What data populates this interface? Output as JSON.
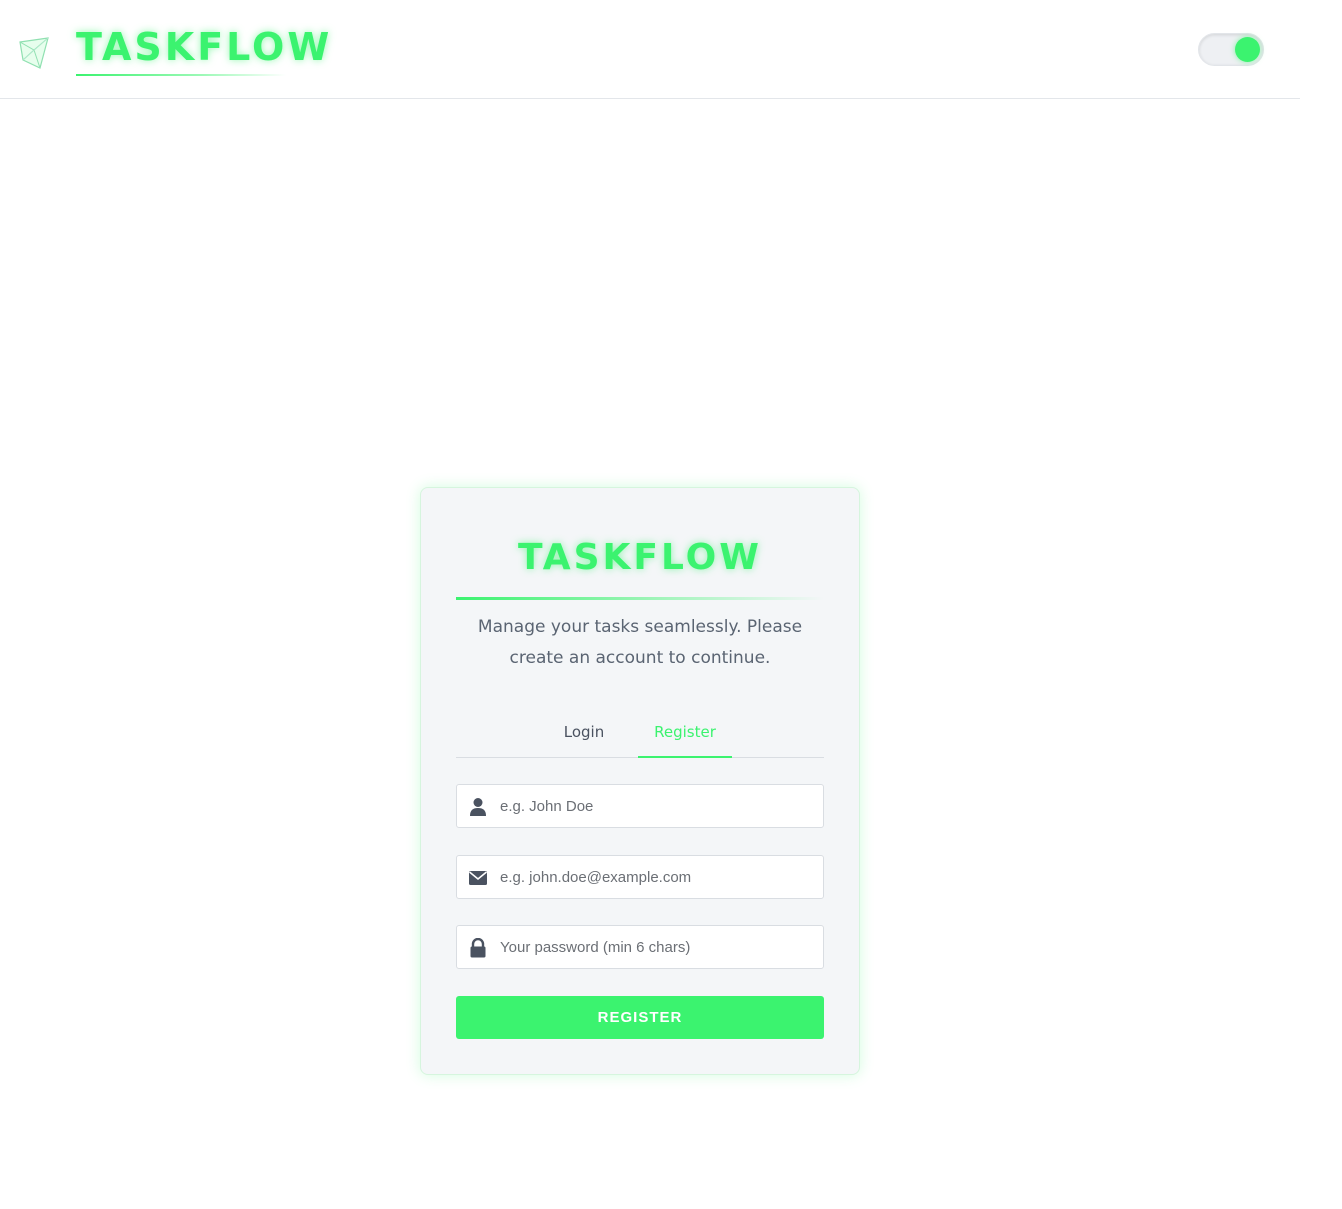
{
  "header": {
    "brand": "TASKFLOW",
    "logo_icon": "crystal-logo-icon",
    "theme_toggle": {
      "icon": "toggle-switch",
      "state": "on"
    }
  },
  "card": {
    "title": "TASKFLOW",
    "subtitle": "Manage your tasks seamlessly. Please create an account to continue.",
    "tabs": [
      {
        "label": "Login",
        "active": false
      },
      {
        "label": "Register",
        "active": true
      }
    ],
    "fields": {
      "name": {
        "icon": "user-icon",
        "placeholder": "e.g. John Doe",
        "value": ""
      },
      "email": {
        "icon": "envelope-icon",
        "placeholder": "e.g. john.doe@example.com",
        "value": ""
      },
      "password": {
        "icon": "lock-icon",
        "placeholder": "Your password (min 6 chars)",
        "value": ""
      }
    },
    "submit_label": "REGISTER"
  },
  "colors": {
    "accent": "#3bf36f",
    "text_muted": "#5a6472",
    "card_bg": "#f4f6f8"
  }
}
